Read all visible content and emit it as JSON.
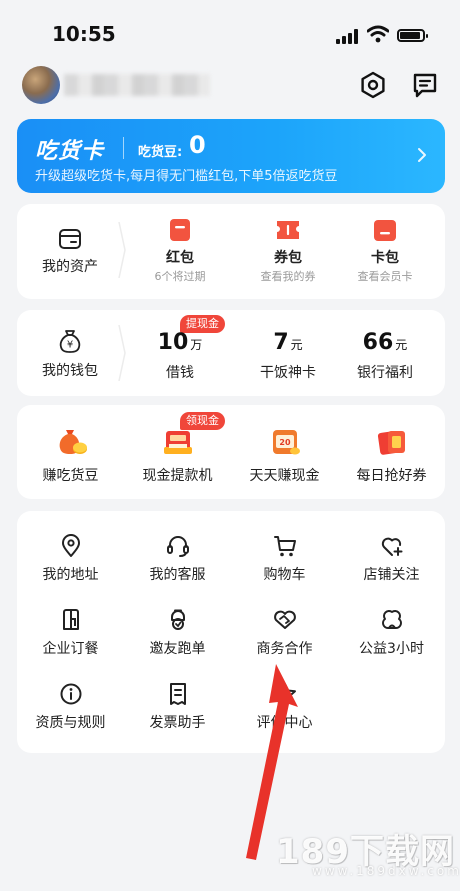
{
  "status_bar": {
    "time": "10:55"
  },
  "foodie_card": {
    "title": "吃货卡",
    "bean_label": "吃货豆:",
    "bean_value": "0",
    "subtitle": "升级超级吃货卡,每月得无门槛红包,下单5倍返吃货豆"
  },
  "assets": {
    "label": "我的资产",
    "items": [
      {
        "label": "红包",
        "sub": "6个将过期"
      },
      {
        "label": "券包",
        "sub": "查看我的券"
      },
      {
        "label": "卡包",
        "sub": "查看会员卡"
      }
    ]
  },
  "wallet": {
    "label": "我的钱包",
    "badge": "提现金",
    "items": [
      {
        "value": "10",
        "unit": "万",
        "label": "借钱"
      },
      {
        "value": "7",
        "unit": "元",
        "label": "干饭神卡"
      },
      {
        "value": "66",
        "unit": "元",
        "label": "银行福利"
      }
    ]
  },
  "promo": {
    "badge": "领现金",
    "coupon_text": "20",
    "items": [
      {
        "label": "赚吃货豆",
        "icon": "coin-bag-icon"
      },
      {
        "label": "现金提款机",
        "icon": "cash-machine-icon"
      },
      {
        "label": "天天赚现金",
        "icon": "cash-calendar-icon"
      },
      {
        "label": "每日抢好券",
        "icon": "coupon-envelope-icon"
      }
    ]
  },
  "tools": {
    "items": [
      {
        "label": "我的地址",
        "icon": "location-pin-icon"
      },
      {
        "label": "我的客服",
        "icon": "headset-icon"
      },
      {
        "label": "购物车",
        "icon": "shopping-cart-icon"
      },
      {
        "label": "店铺关注",
        "icon": "heart-plus-icon"
      },
      {
        "label": "企业订餐",
        "icon": "building-icon"
      },
      {
        "label": "邀友跑单",
        "icon": "rider-icon"
      },
      {
        "label": "商务合作",
        "icon": "handshake-icon"
      },
      {
        "label": "公益3小时",
        "icon": "charity-icon"
      },
      {
        "label": "资质与规则",
        "icon": "info-circle-icon"
      },
      {
        "label": "发票助手",
        "icon": "receipt-icon"
      },
      {
        "label": "评价中心",
        "icon": "star-icon"
      }
    ]
  },
  "watermark": {
    "text": "189下载网",
    "url": "www.189dxw.com"
  },
  "colors": {
    "accent_blue": "#1a8ff6",
    "badge_red": "#f0463a",
    "icon_red": "#f2543f",
    "arrow_red": "#e8322a",
    "background": "#f3f4f6"
  }
}
